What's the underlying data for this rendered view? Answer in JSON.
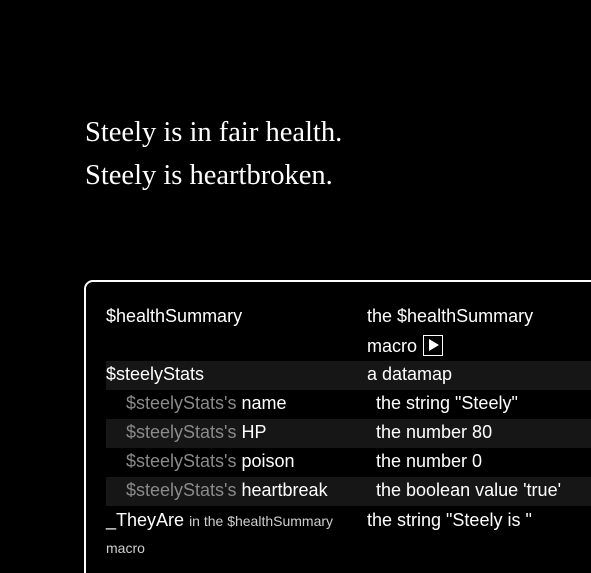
{
  "story": {
    "lines": [
      "Steely is in fair health.",
      "Steely is heartbroken."
    ]
  },
  "variables": {
    "health_summary": {
      "name": "$healthSummary",
      "value_line1": "the $healthSummary",
      "value_line2": "macro"
    },
    "steely_stats": {
      "name": "$steelyStats",
      "value": "a datamap"
    },
    "entries": [
      {
        "owner": "$steelyStats's",
        "key": "name",
        "value": "the string \"Steely\""
      },
      {
        "owner": "$steelyStats's",
        "key": "HP",
        "value": "the number 80"
      },
      {
        "owner": "$steelyStats's",
        "key": "poison",
        "value": "the number 0"
      },
      {
        "owner": "$steelyStats's",
        "key": "heartbreak",
        "value": "the boolean value 'true'"
      }
    ],
    "they_are": {
      "name": "_TheyAre",
      "scope_line1": "in the $healthSummary",
      "scope_line2": "macro",
      "value": "the string \"Steely is \""
    }
  },
  "icons": {
    "play": "play-icon"
  }
}
